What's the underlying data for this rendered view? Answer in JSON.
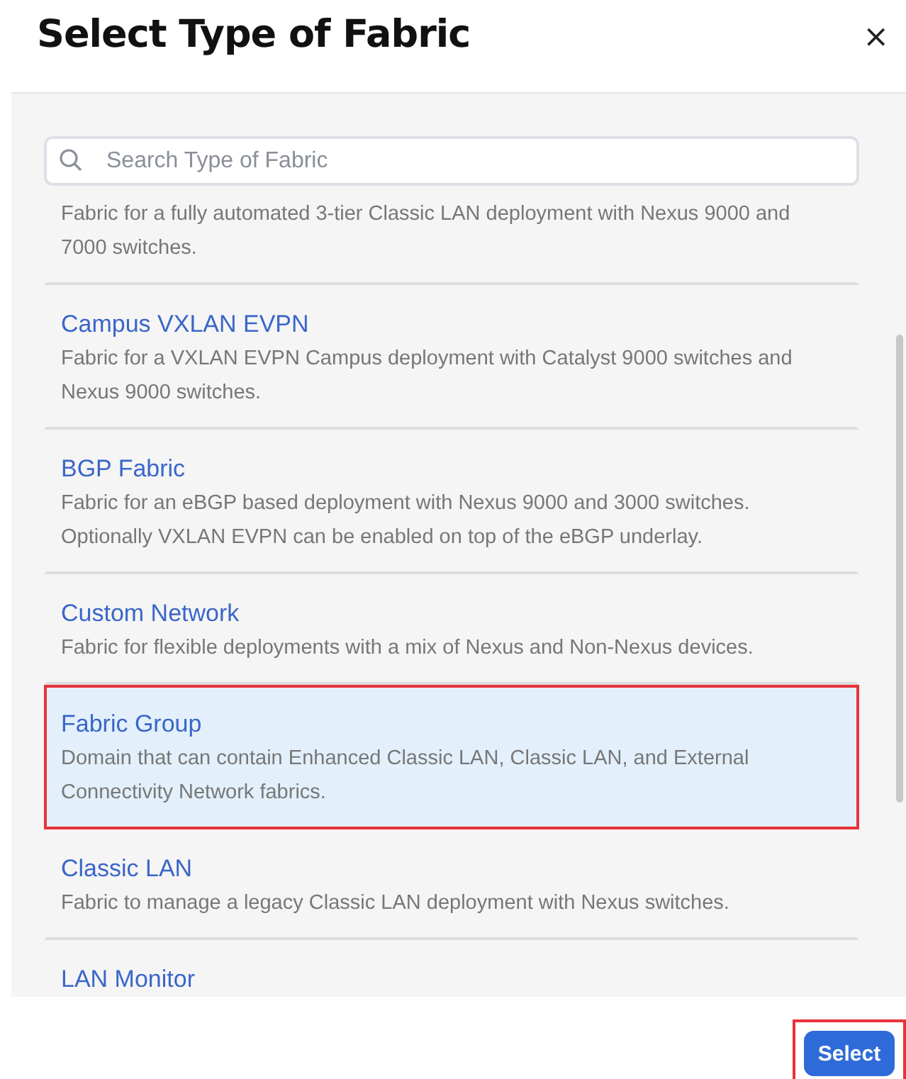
{
  "dialog": {
    "title": "Select Type of Fabric",
    "close": "×"
  },
  "search": {
    "placeholder": "Search Type of Fabric"
  },
  "fabrics": [
    {
      "kind": "partial",
      "description": "Fabric for a fully automated 3-tier Classic LAN deployment with Nexus 9000 and 7000 switches.",
      "selected": false
    },
    {
      "kind": "full",
      "name": "Campus VXLAN EVPN",
      "description": "Fabric for a VXLAN EVPN Campus deployment with Catalyst 9000 switches and Nexus 9000 switches.",
      "selected": false
    },
    {
      "kind": "full",
      "name": "BGP Fabric",
      "description": "Fabric for an eBGP based deployment with Nexus 9000 and 3000 switches. Optionally VXLAN EVPN can be enabled on top of the eBGP underlay.",
      "selected": false
    },
    {
      "kind": "full",
      "name": "Custom Network",
      "description": "Fabric for flexible deployments with a mix of Nexus and Non-Nexus devices.",
      "selected": false
    },
    {
      "kind": "full",
      "name": "Fabric Group",
      "description": "Domain that can contain Enhanced Classic LAN, Classic LAN, and External Connectivity Network fabrics.",
      "selected": true
    },
    {
      "kind": "full",
      "name": "Classic LAN",
      "description": "Fabric to manage a legacy Classic LAN deployment with Nexus switches.",
      "selected": false
    },
    {
      "kind": "title-only",
      "name": "LAN Monitor",
      "selected": false
    }
  ],
  "select_button": {
    "label": "Select",
    "highlighted": true
  }
}
